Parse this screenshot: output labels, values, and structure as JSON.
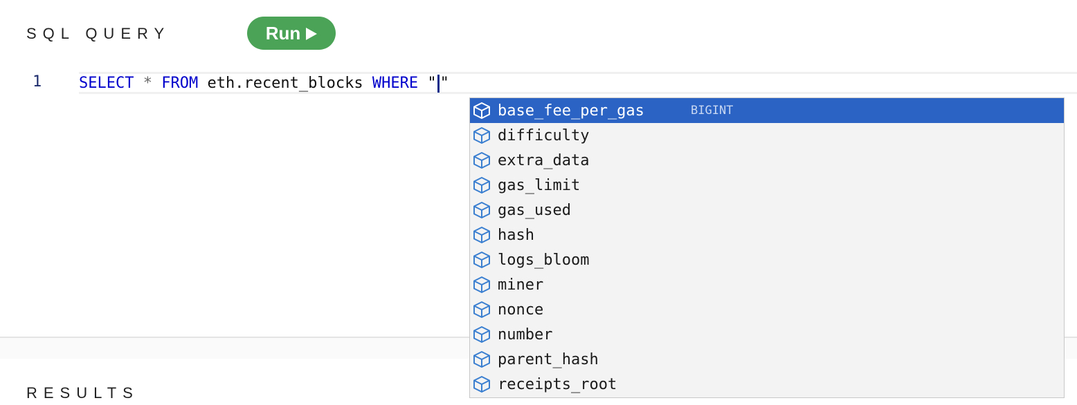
{
  "header": {
    "title": "SQL QUERY",
    "run_label": "Run"
  },
  "editor": {
    "line_number": "1",
    "code": {
      "kw_select": "SELECT",
      "star": "*",
      "kw_from": "FROM",
      "table": "eth.recent_blocks",
      "kw_where": "WHERE",
      "quote_open": "\"",
      "quote_close": "\""
    }
  },
  "autocomplete": {
    "selected_type": "BIGINT",
    "items": [
      "base_fee_per_gas",
      "difficulty",
      "extra_data",
      "gas_limit",
      "gas_used",
      "hash",
      "logs_bloom",
      "miner",
      "nonce",
      "number",
      "parent_hash",
      "receipts_root"
    ],
    "icon": "field-cube-icon"
  },
  "results": {
    "title": "RESULTS"
  },
  "colors": {
    "run_button": "#4aa356",
    "keyword": "#0000cc",
    "selection": "#2b63c4"
  }
}
